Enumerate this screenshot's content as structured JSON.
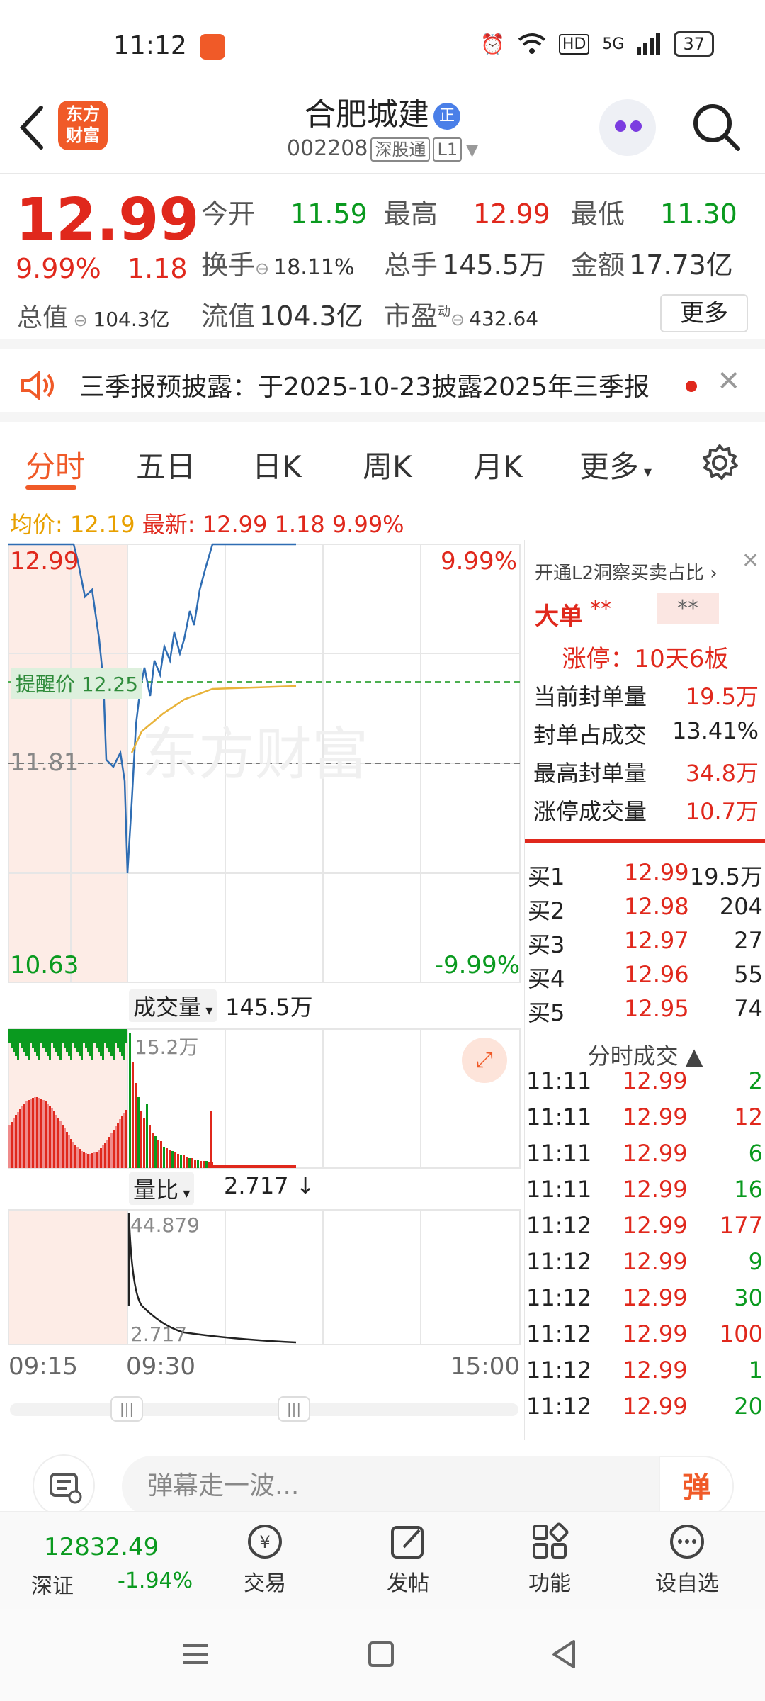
{
  "status": {
    "time": "11:12",
    "hd": "HD",
    "net": "5G",
    "battery": "37"
  },
  "header": {
    "stock_name": "合肥城建",
    "rong_badge": "正",
    "code": "002208",
    "tag1": "深股通",
    "tag2": "L1",
    "logo_text": "东方财富"
  },
  "quote": {
    "price": "12.99",
    "change_pct": "9.99%",
    "change": "1.18",
    "open_label": "今开",
    "open": "11.59",
    "high_label": "最高",
    "high": "12.99",
    "low_label": "最低",
    "low": "11.30",
    "turnover_label": "换手",
    "turnover": "18.11%",
    "volume_label": "总手",
    "volume": "145.5万",
    "amount_label": "金额",
    "amount": "17.73亿",
    "mktcap_label": "总值",
    "mktcap": "104.3亿",
    "float_label": "流值",
    "float_cap": "104.3亿",
    "pe_label": "市盈",
    "pe_sup": "动",
    "pe": "432.64",
    "more_button": "更多"
  },
  "notice": {
    "text": "三季报预披露：于2025-10-23披露2025年三季报"
  },
  "tabs": [
    "分时",
    "五日",
    "日K",
    "周K",
    "月K",
    "更多"
  ],
  "avg_line": {
    "avg_label": "均价:",
    "avg": "12.19",
    "latest_label": "最新:",
    "latest": "12.99",
    "chg": "1.18",
    "pct": "9.99%"
  },
  "chart": {
    "top_price": "12.99",
    "top_pct": "9.99%",
    "mid_price": "11.81",
    "bot_price": "10.63",
    "bot_pct": "-9.99%",
    "alert_label": "提醒价 12.25",
    "watermark": "东方财富",
    "vol_label": "成交量",
    "vol_value": "145.5万",
    "vol_max": "15.2万",
    "ratio_label": "量比",
    "ratio_value": "2.717",
    "ratio_top": "44.879",
    "ratio_bot": "2.717",
    "time_start": "09:15",
    "time_open": "09:30",
    "time_end": "15:00",
    "colors": {
      "up": "#e0281c",
      "down": "#0a9a1f",
      "price_line": "#2f6db3",
      "avg_line": "#e8b33a",
      "preopen_bg": "#fdece6"
    }
  },
  "chart_data": {
    "type": "line",
    "ylim": [
      10.63,
      12.99
    ],
    "x": [
      "09:15",
      "09:20",
      "09:25",
      "09:30",
      "09:35",
      "09:40",
      "09:45",
      "09:50",
      "09:55",
      "10:00",
      "10:30",
      "11:12"
    ],
    "series": [
      {
        "name": "价格",
        "values": [
          12.99,
          12.99,
          12.68,
          11.5,
          12.2,
          12.45,
          12.6,
          12.4,
          12.7,
          12.99,
          12.99,
          12.99
        ]
      },
      {
        "name": "均价",
        "values": [
          null,
          null,
          null,
          11.55,
          11.85,
          11.98,
          12.05,
          12.1,
          12.14,
          12.17,
          12.19,
          12.19
        ]
      }
    ],
    "volume": {
      "max": "15.2万"
    },
    "volume_ratio": {
      "top": 44.879,
      "last": 2.717
    }
  },
  "book": {
    "open_l2": "开通L2洞察买卖占比 ›",
    "big": "大单",
    "stars": "**",
    "stars2": "**",
    "limit_info": "涨停：10天6板",
    "rows": [
      {
        "label": "当前封单量",
        "value": "19.5万"
      },
      {
        "label": "封单占成交",
        "value": "13.41%"
      },
      {
        "label": "最高封单量",
        "value": "34.8万"
      },
      {
        "label": "涨停成交量",
        "value": "10.7万"
      }
    ],
    "bids": [
      {
        "n": "买1",
        "p": "12.99",
        "q": "19.5万"
      },
      {
        "n": "买2",
        "p": "12.98",
        "q": "204"
      },
      {
        "n": "买3",
        "p": "12.97",
        "q": "27"
      },
      {
        "n": "买4",
        "p": "12.96",
        "q": "55"
      },
      {
        "n": "买5",
        "p": "12.95",
        "q": "74"
      }
    ],
    "ticks_header": "分时成交 ▲",
    "ticks": [
      {
        "t": "11:11",
        "p": "12.99",
        "q": "2"
      },
      {
        "t": "11:11",
        "p": "12.99",
        "q": "12"
      },
      {
        "t": "11:11",
        "p": "12.99",
        "q": "6"
      },
      {
        "t": "11:11",
        "p": "12.99",
        "q": "16"
      },
      {
        "t": "11:12",
        "p": "12.99",
        "q": "177"
      },
      {
        "t": "11:12",
        "p": "12.99",
        "q": "9"
      },
      {
        "t": "11:12",
        "p": "12.99",
        "q": "30"
      },
      {
        "t": "11:12",
        "p": "12.99",
        "q": "100"
      },
      {
        "t": "11:12",
        "p": "12.99",
        "q": "1"
      },
      {
        "t": "11:12",
        "p": "12.99",
        "q": "20"
      }
    ]
  },
  "danmu": {
    "placeholder": "弹幕走一波...",
    "button": "弹"
  },
  "bottom": {
    "index_value": "12832.49",
    "index_name": "深证",
    "index_pct": "-1.94%",
    "nav": [
      "交易",
      "发帖",
      "功能",
      "设自选"
    ]
  }
}
